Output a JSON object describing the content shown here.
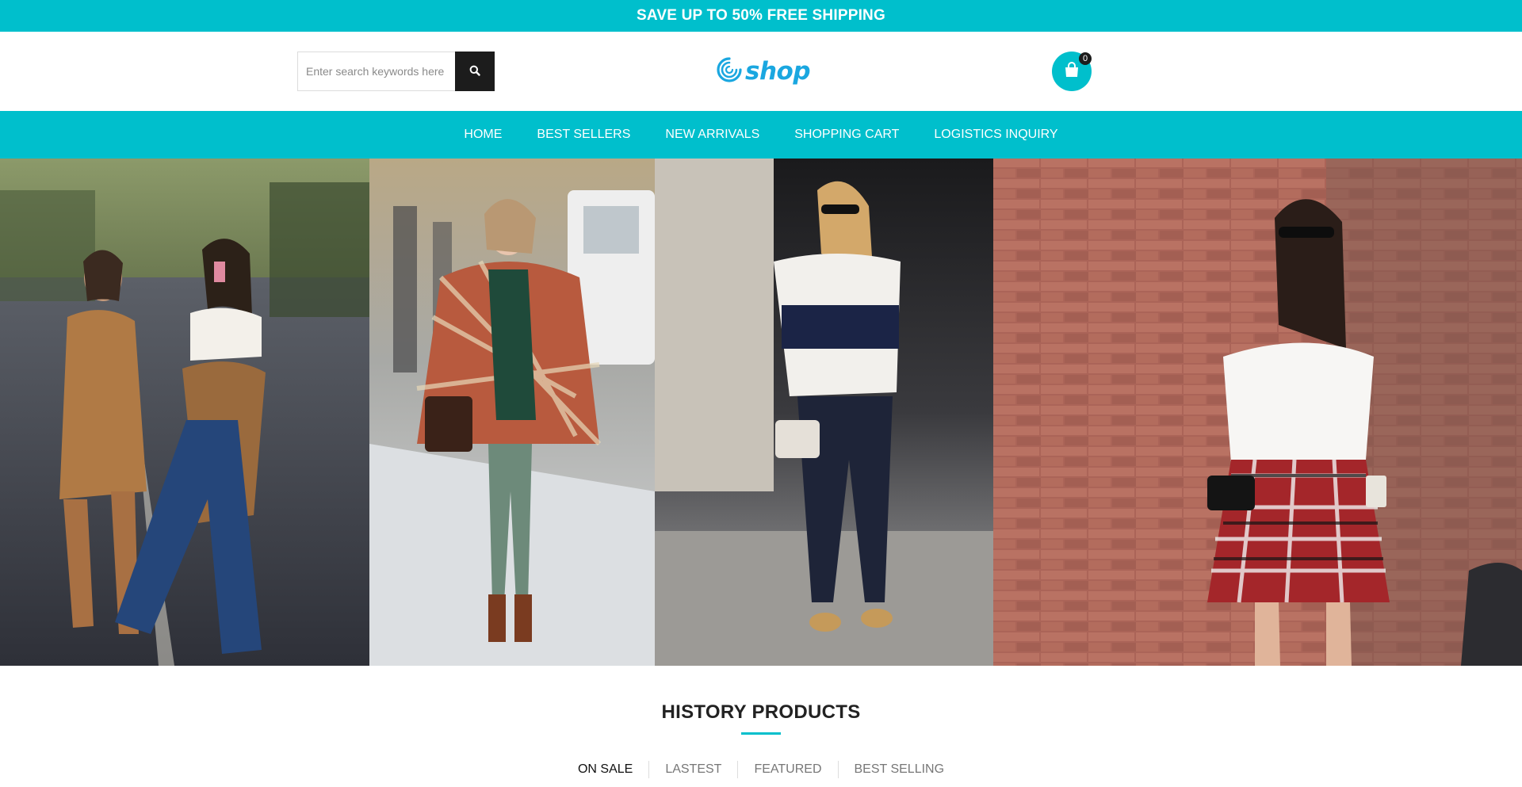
{
  "promo": {
    "text": "SAVE UP TO 50% FREE SHIPPING"
  },
  "search": {
    "placeholder": "Enter search keywords here",
    "value": "",
    "button_icon": "search-icon"
  },
  "logo": {
    "text": "shop",
    "icon": "swirl-logo-icon"
  },
  "cart": {
    "count": "0",
    "icon": "shopping-bag-icon"
  },
  "nav": {
    "items": [
      {
        "label": "HOME"
      },
      {
        "label": "BEST SELLERS"
      },
      {
        "label": "NEW ARRIVALS"
      },
      {
        "label": "SHOPPING CART"
      },
      {
        "label": "LOGISTICS INQUIRY"
      }
    ]
  },
  "banner": {
    "panels": [
      {
        "name": "street-style-duo"
      },
      {
        "name": "plaid-poncho"
      },
      {
        "name": "striped-tee-jeans"
      },
      {
        "name": "plaid-skirt-coffee"
      }
    ]
  },
  "section": {
    "title": "HISTORY PRODUCTS",
    "tabs": [
      {
        "label": "ON SALE",
        "active": true
      },
      {
        "label": "LASTEST",
        "active": false
      },
      {
        "label": "FEATURED",
        "active": false
      },
      {
        "label": "BEST SELLING",
        "active": false
      }
    ]
  },
  "colors": {
    "accent": "#00bfcc",
    "dark": "#1c1c1c",
    "logo": "#1aa7e0"
  }
}
